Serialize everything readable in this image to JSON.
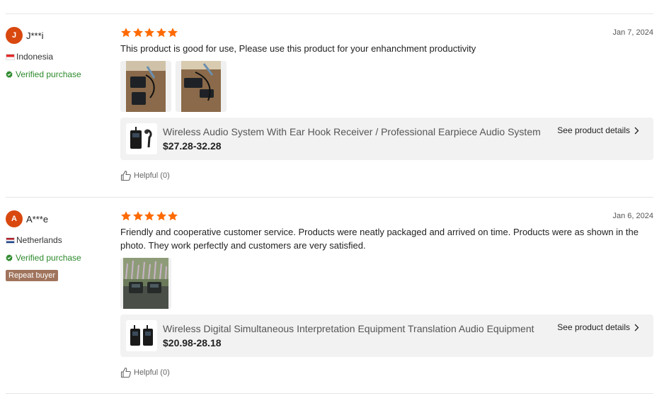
{
  "reviews": [
    {
      "avatar_initial": "J",
      "username": "J***i",
      "country": "Indonesia",
      "verified": "Verified purchase",
      "date": "Jan 7, 2024",
      "text": "This product is good for use, Please use this product for your enhanchment productivity",
      "rating": 5,
      "product": {
        "title": "Wireless Audio System With Ear Hook Receiver / Professional Earpiece Audio System",
        "price": "$27.28-32.28",
        "see_details": "See product details"
      },
      "helpful": "Helpful (0)"
    },
    {
      "avatar_initial": "A",
      "username": "A***e",
      "country": "Netherlands",
      "verified": "Verified purchase",
      "badge": "Repeat buyer",
      "date": "Jan 6, 2024",
      "text": "Friendly and cooperative customer service. Products were neatly packaged and arrived on time. Products were as shown in the photo. They work perfectly and customers are very satisfied.",
      "rating": 5,
      "product": {
        "title": "Wireless Digital Simultaneous Interpretation Equipment Translation Audio Equipment",
        "price": "$20.98-28.18",
        "see_details": "See product details"
      },
      "helpful": "Helpful (0)"
    }
  ],
  "colors": {
    "star": "#ff6a00",
    "avatar": "#d9480f",
    "verified": "#2d8a2d",
    "repeat_badge": "#a0745c"
  }
}
